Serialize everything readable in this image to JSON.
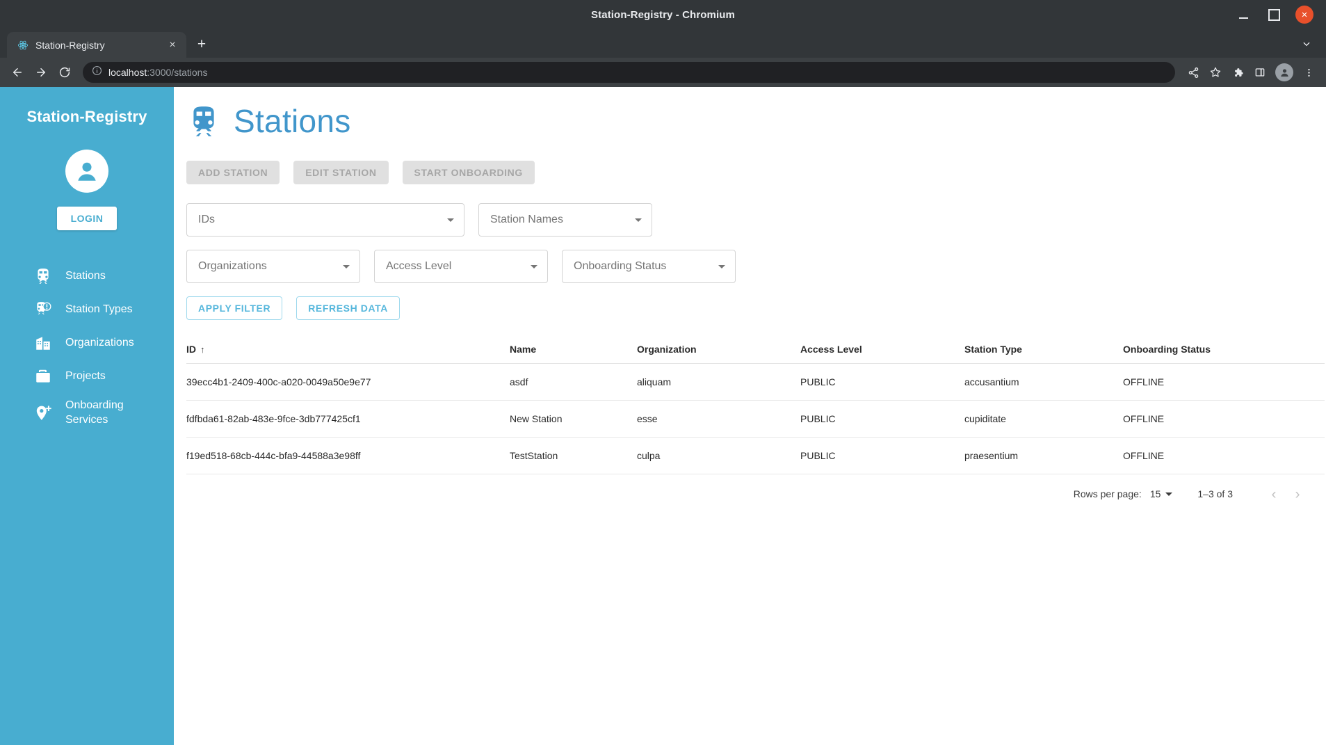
{
  "window": {
    "title": "Station-Registry - Chromium",
    "minimize_label": "Minimize",
    "maximize_label": "Maximize",
    "close_label": "×"
  },
  "browser": {
    "tab": {
      "title": "Station-Registry",
      "close_label": "×",
      "favicon": "react-logo-icon"
    },
    "new_tab_label": "+",
    "toolbar": {
      "back_label": "←",
      "forward_label": "→",
      "reload_label": "⟳",
      "url_host": "localhost",
      "url_path": ":3000/stations",
      "site_info_icon": "info-circle-icon"
    },
    "actions": [
      "share-icon",
      "bookmark-star-icon",
      "extensions-puzzle-icon",
      "side-panel-icon",
      "profile-avatar-icon",
      "more-menu-icon"
    ]
  },
  "sidebar": {
    "brand": "Station-Registry",
    "login_label": "LOGIN",
    "items": [
      {
        "label": "Stations",
        "icon": "train-icon"
      },
      {
        "label": "Station Types",
        "icon": "train-alert-icon"
      },
      {
        "label": "Organizations",
        "icon": "building-icon"
      },
      {
        "label": "Projects",
        "icon": "briefcase-icon"
      },
      {
        "label": "Onboarding Services",
        "icon": "map-pin-plus-icon"
      }
    ],
    "color": "#48ADD0"
  },
  "page": {
    "title": "Stations",
    "title_icon": "train-icon",
    "title_color": "#4196CB",
    "actions": [
      {
        "label": "ADD STATION",
        "disabled": true
      },
      {
        "label": "EDIT STATION",
        "disabled": true
      },
      {
        "label": "START ONBOARDING",
        "disabled": true
      }
    ],
    "filters": [
      {
        "label": "IDs",
        "value": ""
      },
      {
        "label": "Station Names",
        "value": ""
      },
      {
        "label": "Organizations",
        "value": ""
      },
      {
        "label": "Access Level",
        "value": ""
      },
      {
        "label": "Onboarding Status",
        "value": ""
      }
    ],
    "filter_buttons": [
      {
        "label": "APPLY FILTER"
      },
      {
        "label": "REFRESH DATA"
      }
    ],
    "table": {
      "columns": [
        "ID",
        "Name",
        "Organization",
        "Access Level",
        "Station Type",
        "Onboarding Status"
      ],
      "sort_column": "ID",
      "sort_arrow": "↑",
      "rows": [
        {
          "id": "39ecc4b1-2409-400c-a020-0049a50e9e77",
          "name": "asdf",
          "organization": "aliquam",
          "access_level": "PUBLIC",
          "station_type": "accusantium",
          "onboarding_status": "OFFLINE"
        },
        {
          "id": "fdfbda61-82ab-483e-9fce-3db777425cf1",
          "name": "New Station",
          "organization": "esse",
          "access_level": "PUBLIC",
          "station_type": "cupiditate",
          "onboarding_status": "OFFLINE"
        },
        {
          "id": "f19ed518-68cb-444c-bfa9-44588a3e98ff",
          "name": "TestStation",
          "organization": "culpa",
          "access_level": "PUBLIC",
          "station_type": "praesentium",
          "onboarding_status": "OFFLINE"
        }
      ]
    },
    "pagination": {
      "rows_per_page_label": "Rows per page:",
      "rows_per_page_value": "15",
      "range_label": "1–3 of 3",
      "prev_label": "‹",
      "next_label": "›"
    }
  }
}
